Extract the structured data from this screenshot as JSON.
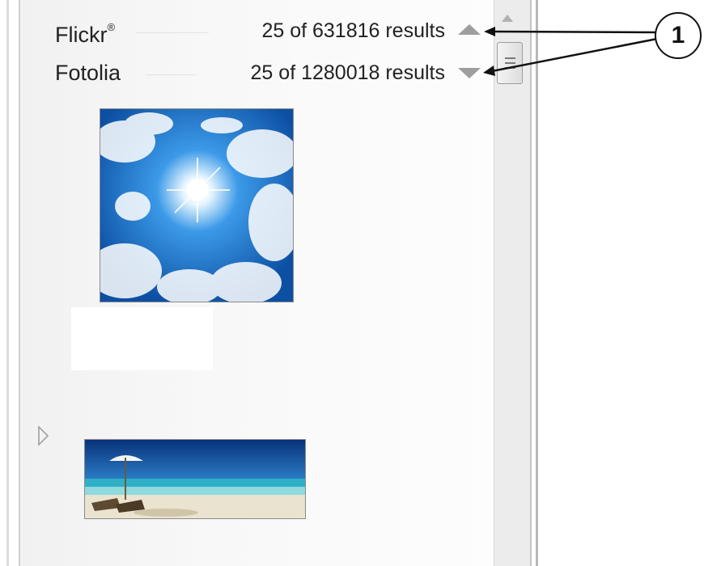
{
  "sources": [
    {
      "name": "Flickr",
      "mark": "®",
      "count_text": "25 of 631816 results",
      "sort_icon": "triangle-up-icon"
    },
    {
      "name": "Fotolia",
      "mark": "",
      "count_text": "25 of 1280018 results",
      "sort_icon": "triangle-down-icon"
    }
  ],
  "callout": {
    "label": "1"
  },
  "images": [
    {
      "subject": "sunlit sky with clouds"
    },
    {
      "subject": "beach with umbrella and loungers"
    }
  ],
  "colors": {
    "arrow_gray": "#9e9e9e",
    "callout_ink": "#111111",
    "sky_blue": "#1f6fc2"
  }
}
